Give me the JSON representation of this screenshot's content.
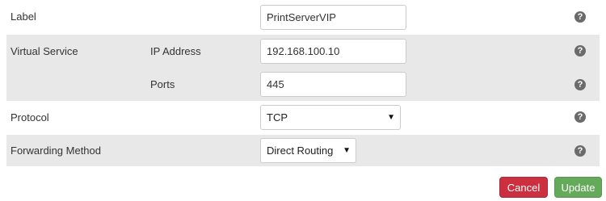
{
  "fields": {
    "label": {
      "label": "Label",
      "value": "PrintServerVIP"
    },
    "virtual_service": {
      "label": "Virtual Service",
      "ip_address": {
        "label": "IP Address",
        "value": "192.168.100.10"
      },
      "ports": {
        "label": "Ports",
        "value": "445"
      }
    },
    "protocol": {
      "label": "Protocol",
      "selected": "TCP"
    },
    "forwarding_method": {
      "label": "Forwarding Method",
      "selected": "Direct Routing"
    }
  },
  "help_glyph": "?",
  "icons": {
    "help": "help-circle-icon",
    "dropdown": "caret-down-icon"
  },
  "buttons": {
    "cancel": "Cancel",
    "update": "Update"
  },
  "colors": {
    "cancel": "#cc3040",
    "update": "#65a95a",
    "row_shade": "#e8e8e8",
    "help_icon": "#6b6b6b"
  }
}
